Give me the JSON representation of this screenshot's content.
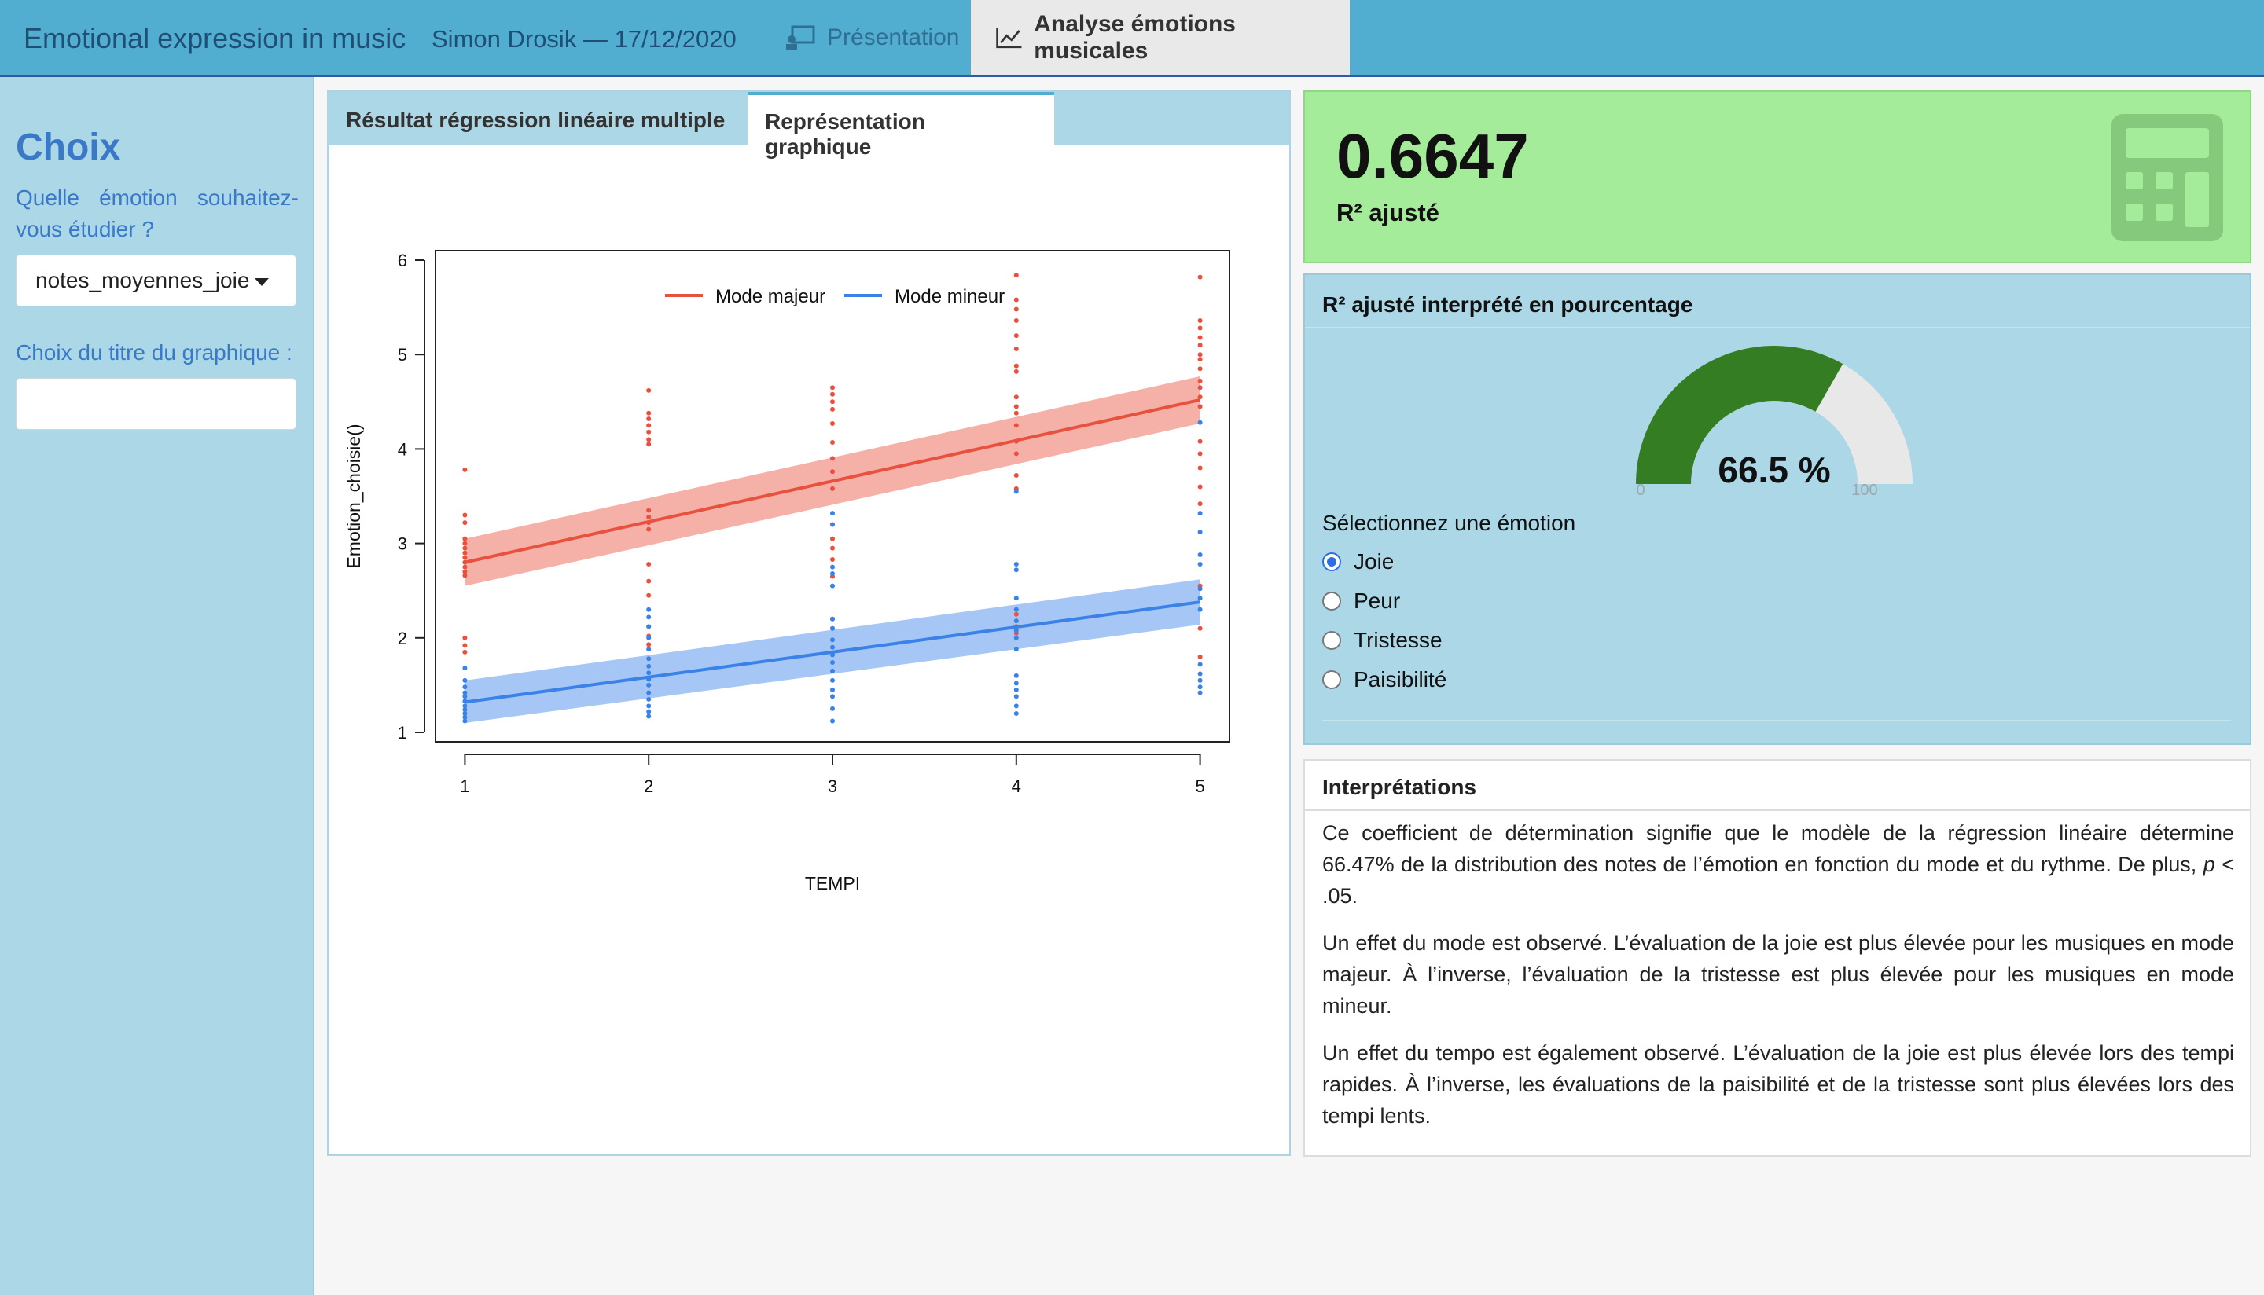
{
  "header": {
    "brand": "Emotional expression in music",
    "author": "Simon Drosik — 17/12/2020",
    "tabs": [
      {
        "label": "Présentation",
        "icon": "presentation-icon"
      },
      {
        "label": "Analyse émotions musicales",
        "icon": "line-chart-icon"
      }
    ]
  },
  "sidebar": {
    "title": "Choix",
    "question": "Quelle émotion souhaitez-vous étudier ?",
    "select_value": "notes_moyennes_joie",
    "title_label": "Choix du titre du graphique :",
    "title_input_value": ""
  },
  "center": {
    "tabs": [
      "Résultat régression linéaire multiple",
      "Représentation graphique"
    ],
    "active_tab": "Représentation graphique"
  },
  "chart_data": {
    "type": "scatter",
    "title": "",
    "xlabel": "TEMPI",
    "ylabel": "Emotion_choisie()",
    "xlim": [
      0.84,
      5.16
    ],
    "ylim": [
      0.9,
      6.1
    ],
    "xticks": [
      1,
      2,
      3,
      4,
      5
    ],
    "yticks": [
      1,
      2,
      3,
      4,
      5,
      6
    ],
    "legend_position": "top",
    "series": [
      {
        "name": "Mode majeur",
        "color": "#e8513d",
        "fit": {
          "x": [
            1,
            5
          ],
          "y": [
            2.8,
            4.52
          ]
        },
        "ci_upper": [
          3.05,
          4.77
        ],
        "ci_lower": [
          2.55,
          4.27
        ],
        "points": [
          [
            1,
            3.78
          ],
          [
            1,
            3.3
          ],
          [
            1,
            3.22
          ],
          [
            1,
            3.05
          ],
          [
            1,
            3.0
          ],
          [
            1,
            2.95
          ],
          [
            1,
            2.9
          ],
          [
            1,
            2.85
          ],
          [
            1,
            2.8
          ],
          [
            1,
            2.75
          ],
          [
            1,
            2.7
          ],
          [
            1,
            2.66
          ],
          [
            1,
            2.0
          ],
          [
            1,
            1.92
          ],
          [
            1,
            1.85
          ],
          [
            2,
            4.62
          ],
          [
            2,
            4.38
          ],
          [
            2,
            4.32
          ],
          [
            2,
            4.25
          ],
          [
            2,
            4.18
          ],
          [
            2,
            4.1
          ],
          [
            2,
            4.05
          ],
          [
            2,
            3.35
          ],
          [
            2,
            3.28
          ],
          [
            2,
            3.22
          ],
          [
            2,
            3.15
          ],
          [
            2,
            2.78
          ],
          [
            2,
            2.6
          ],
          [
            2,
            2.45
          ],
          [
            2,
            2.12
          ],
          [
            2,
            2.02
          ],
          [
            2,
            1.93
          ],
          [
            3,
            4.65
          ],
          [
            3,
            4.58
          ],
          [
            3,
            4.5
          ],
          [
            3,
            4.42
          ],
          [
            3,
            4.27
          ],
          [
            3,
            4.07
          ],
          [
            3,
            3.9
          ],
          [
            3,
            3.76
          ],
          [
            3,
            3.58
          ],
          [
            3,
            3.2
          ],
          [
            3,
            3.05
          ],
          [
            3,
            2.95
          ],
          [
            3,
            2.83
          ],
          [
            3,
            2.65
          ],
          [
            3,
            2.2
          ],
          [
            3,
            2.1
          ],
          [
            4,
            5.84
          ],
          [
            4,
            5.58
          ],
          [
            4,
            5.48
          ],
          [
            4,
            5.36
          ],
          [
            4,
            5.2
          ],
          [
            4,
            5.06
          ],
          [
            4,
            4.88
          ],
          [
            4,
            4.82
          ],
          [
            4,
            4.55
          ],
          [
            4,
            4.45
          ],
          [
            4,
            4.38
          ],
          [
            4,
            4.25
          ],
          [
            4,
            4.08
          ],
          [
            4,
            3.95
          ],
          [
            4,
            3.72
          ],
          [
            4,
            3.58
          ],
          [
            4,
            2.25
          ],
          [
            4,
            2.12
          ],
          [
            4,
            2.05
          ],
          [
            5,
            5.82
          ],
          [
            5,
            5.36
          ],
          [
            5,
            5.28
          ],
          [
            5,
            5.18
          ],
          [
            5,
            5.1
          ],
          [
            5,
            5.0
          ],
          [
            5,
            4.95
          ],
          [
            5,
            4.85
          ],
          [
            5,
            4.72
          ],
          [
            5,
            4.65
          ],
          [
            5,
            4.55
          ],
          [
            5,
            4.45
          ],
          [
            5,
            4.08
          ],
          [
            5,
            3.95
          ],
          [
            5,
            3.8
          ],
          [
            5,
            3.6
          ],
          [
            5,
            3.42
          ],
          [
            5,
            2.55
          ],
          [
            5,
            2.1
          ],
          [
            5,
            1.8
          ]
        ]
      },
      {
        "name": "Mode mineur",
        "color": "#3a82e8",
        "fit": {
          "x": [
            1,
            5
          ],
          "y": [
            1.32,
            2.38
          ]
        },
        "ci_upper": [
          1.55,
          2.62
        ],
        "ci_lower": [
          1.1,
          2.14
        ],
        "points": [
          [
            1,
            1.68
          ],
          [
            1,
            1.55
          ],
          [
            1,
            1.48
          ],
          [
            1,
            1.42
          ],
          [
            1,
            1.38
          ],
          [
            1,
            1.33
          ],
          [
            1,
            1.28
          ],
          [
            1,
            1.24
          ],
          [
            1,
            1.2
          ],
          [
            1,
            1.16
          ],
          [
            1,
            1.12
          ],
          [
            2,
            2.3
          ],
          [
            2,
            2.22
          ],
          [
            2,
            2.12
          ],
          [
            2,
            2.0
          ],
          [
            2,
            1.88
          ],
          [
            2,
            1.78
          ],
          [
            2,
            1.7
          ],
          [
            2,
            1.63
          ],
          [
            2,
            1.56
          ],
          [
            2,
            1.5
          ],
          [
            2,
            1.42
          ],
          [
            2,
            1.35
          ],
          [
            2,
            1.28
          ],
          [
            2,
            1.22
          ],
          [
            2,
            1.17
          ],
          [
            3,
            3.32
          ],
          [
            3,
            3.2
          ],
          [
            3,
            2.75
          ],
          [
            3,
            2.68
          ],
          [
            3,
            2.55
          ],
          [
            3,
            2.2
          ],
          [
            3,
            2.1
          ],
          [
            3,
            1.98
          ],
          [
            3,
            1.9
          ],
          [
            3,
            1.82
          ],
          [
            3,
            1.74
          ],
          [
            3,
            1.65
          ],
          [
            3,
            1.55
          ],
          [
            3,
            1.45
          ],
          [
            3,
            1.38
          ],
          [
            3,
            1.25
          ],
          [
            3,
            1.12
          ],
          [
            4,
            3.55
          ],
          [
            4,
            2.78
          ],
          [
            4,
            2.72
          ],
          [
            4,
            2.42
          ],
          [
            4,
            2.3
          ],
          [
            4,
            2.18
          ],
          [
            4,
            2.08
          ],
          [
            4,
            2.0
          ],
          [
            4,
            1.88
          ],
          [
            4,
            1.6
          ],
          [
            4,
            1.52
          ],
          [
            4,
            1.45
          ],
          [
            4,
            1.38
          ],
          [
            4,
            1.28
          ],
          [
            4,
            1.2
          ],
          [
            5,
            4.28
          ],
          [
            5,
            3.32
          ],
          [
            5,
            3.12
          ],
          [
            5,
            2.88
          ],
          [
            5,
            2.78
          ],
          [
            5,
            2.52
          ],
          [
            5,
            2.42
          ],
          [
            5,
            2.3
          ],
          [
            5,
            1.72
          ],
          [
            5,
            1.62
          ],
          [
            5,
            1.55
          ],
          [
            5,
            1.48
          ],
          [
            5,
            1.42
          ]
        ]
      }
    ]
  },
  "valuebox": {
    "value": "0.6647",
    "label": "R² ajusté",
    "icon": "calculator-icon",
    "color": "#a5ec9a"
  },
  "gauge": {
    "title": "R² ajusté interprété en pourcentage",
    "value": 66.5,
    "min_label": "0",
    "max_label": "100",
    "display": "66.5 %",
    "fill_color": "#347d22",
    "track_color": "#e8e8e8",
    "select_label": "Sélectionnez une émotion",
    "options": [
      "Joie",
      "Peur",
      "Tristesse",
      "Paisibilité"
    ],
    "selected": "Joie"
  },
  "interpretations": {
    "title": "Interprétations",
    "p1a": "Ce coefficient de détermination signifie que le modèle de la régression linéaire détermine 66.47% de la distribution des notes de l’émotion en fonction du mode et du rythme. De plus, ",
    "p1b": "p",
    "p1c": " < .05.",
    "p2": "Un effet du mode est observé. L’évaluation de la joie est plus élevée pour les musiques en mode majeur. À l’inverse, l’évaluation de la tristesse est plus élevée pour les musiques en mode mineur.",
    "p3": "Un effet du tempo est également observé. L’évaluation de la joie est plus élevée lors des tempi rapides. À l’inverse, les évaluations de la paisibilité et de la tristesse sont plus élevées lors des tempi lents."
  }
}
